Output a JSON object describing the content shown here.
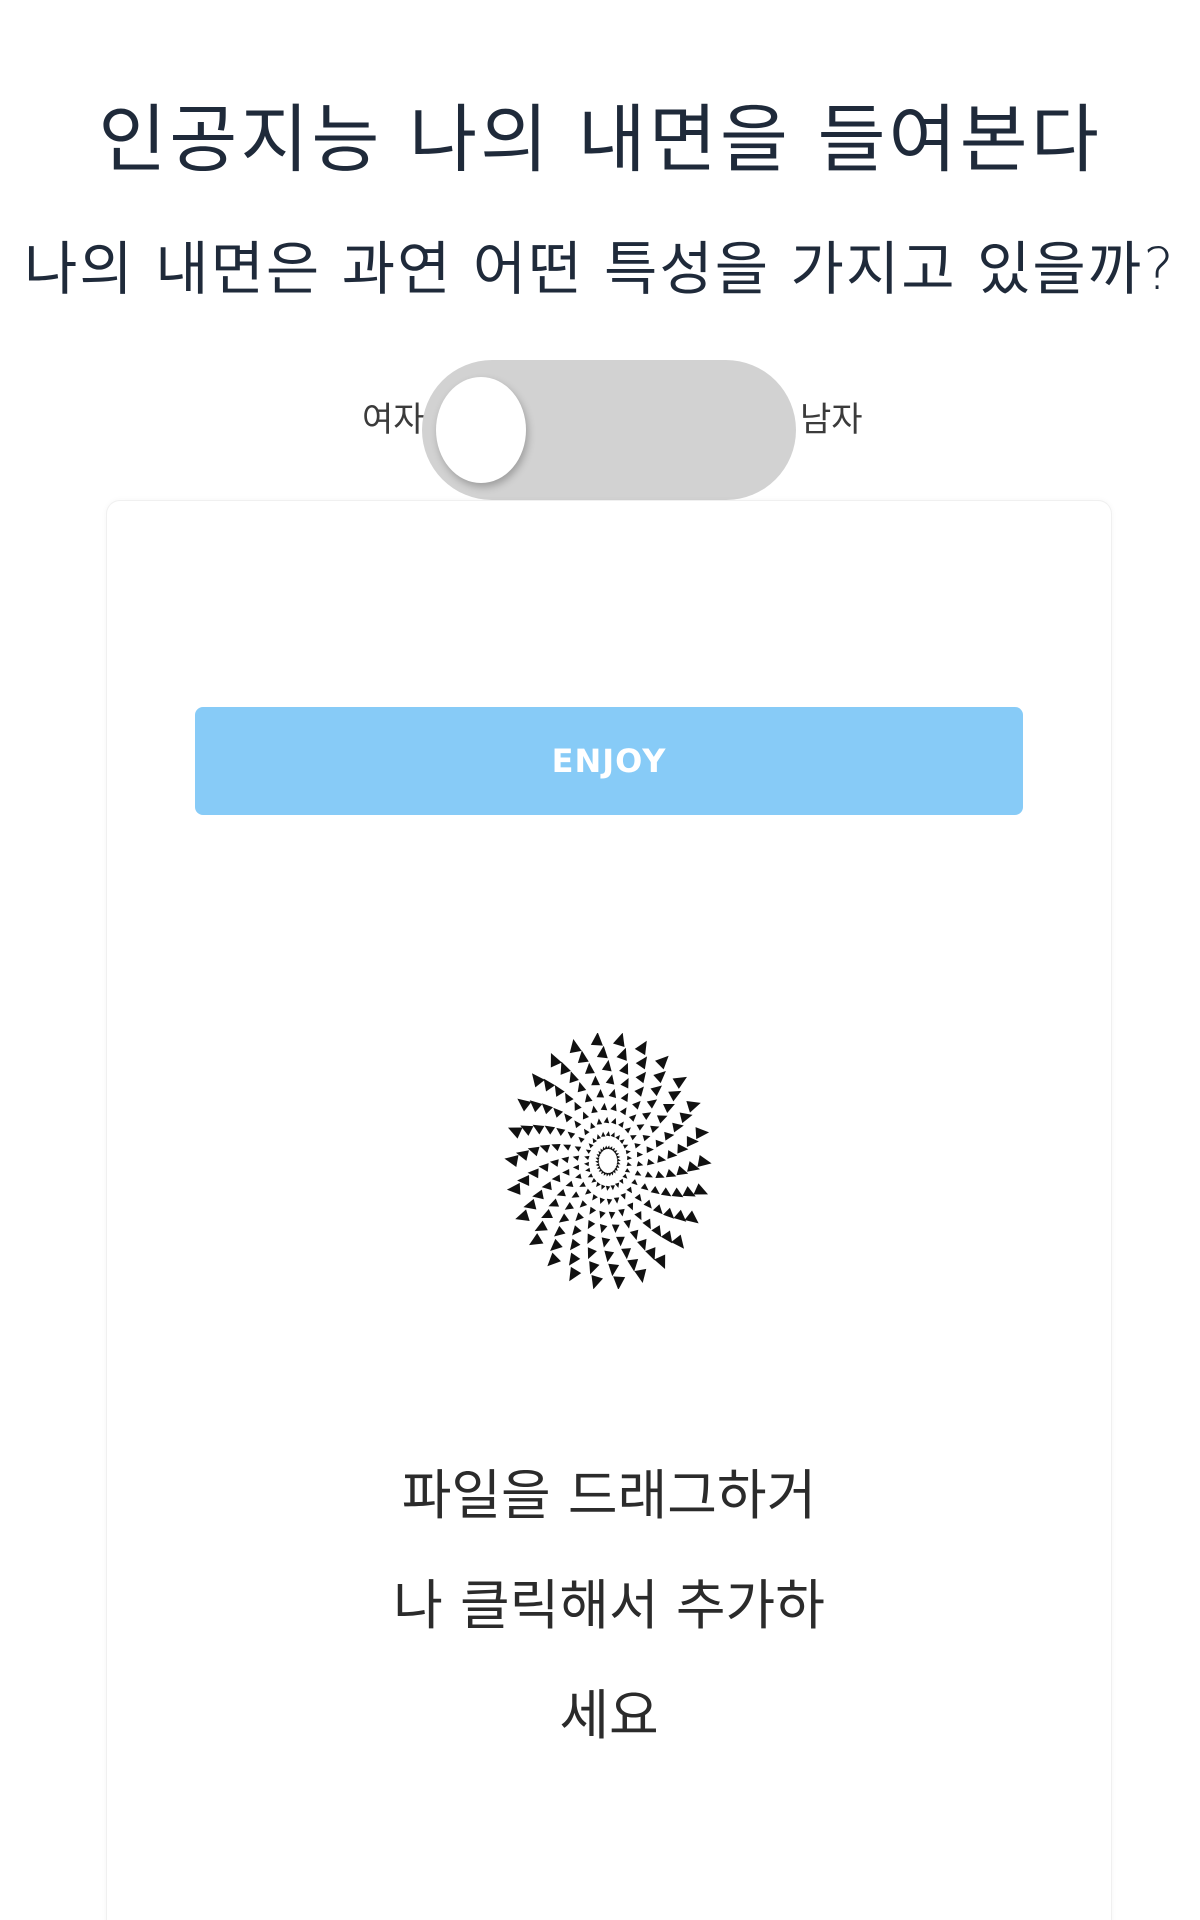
{
  "header": {
    "title": "인공지능 나의 내면을 들여본다",
    "subtitle": "나의 내면은 과연 어떤 특성을 가지고 있을까?"
  },
  "gender_toggle": {
    "left_label": "여자",
    "right_label": "남자",
    "selected": "여자",
    "track_color": "#d2d2d2"
  },
  "card": {
    "button_label": "ENJOY",
    "button_color": "#87cbf7",
    "spinner_icon": "spiral-arrows-icon",
    "drop_lines": [
      "파일을 드래그하거",
      "나 클릭해서 추가하",
      "세요"
    ]
  }
}
